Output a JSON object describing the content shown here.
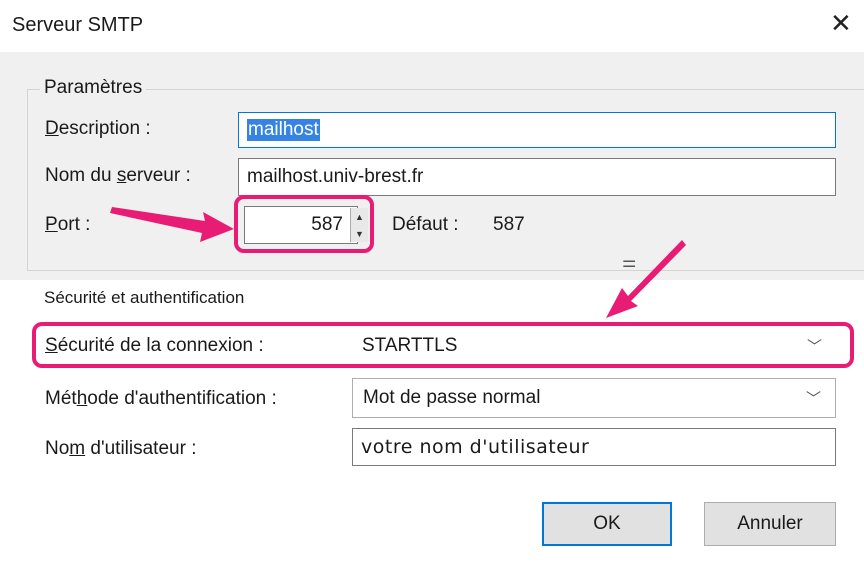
{
  "window": {
    "title": "Serveur SMTP",
    "close_glyph": "✕"
  },
  "parametres": {
    "legend": "Paramètres",
    "description_label_u": "D",
    "description_label_rest": "escription :",
    "description_value": "mailhost",
    "server_label_pre": "Nom du ",
    "server_label_u": "s",
    "server_label_rest": "erveur :",
    "server_value": "mailhost.univ-brest.fr",
    "port_label_u": "P",
    "port_label_rest": "ort :",
    "port_value": "587",
    "default_label": "Défaut :",
    "default_value": "587"
  },
  "securite": {
    "heading": "Sécurité et authentification",
    "connexion_label_u": "S",
    "connexion_label_rest": "écurité de la connexion :",
    "connexion_value": "STARTTLS",
    "auth_label_pre": "Mét",
    "auth_label_u": "h",
    "auth_label_rest": "ode d'authentification :",
    "auth_value": "Mot de passe normal",
    "user_label_pre": "No",
    "user_label_u": "m",
    "user_label_rest": " d'utilisateur :",
    "user_value": "votre nom d'utilisateur"
  },
  "buttons": {
    "ok": "OK",
    "cancel": "Annuler"
  },
  "colors": {
    "highlight": "#e81c74",
    "selection": "#3584e4",
    "focus_border": "#0078d7"
  }
}
